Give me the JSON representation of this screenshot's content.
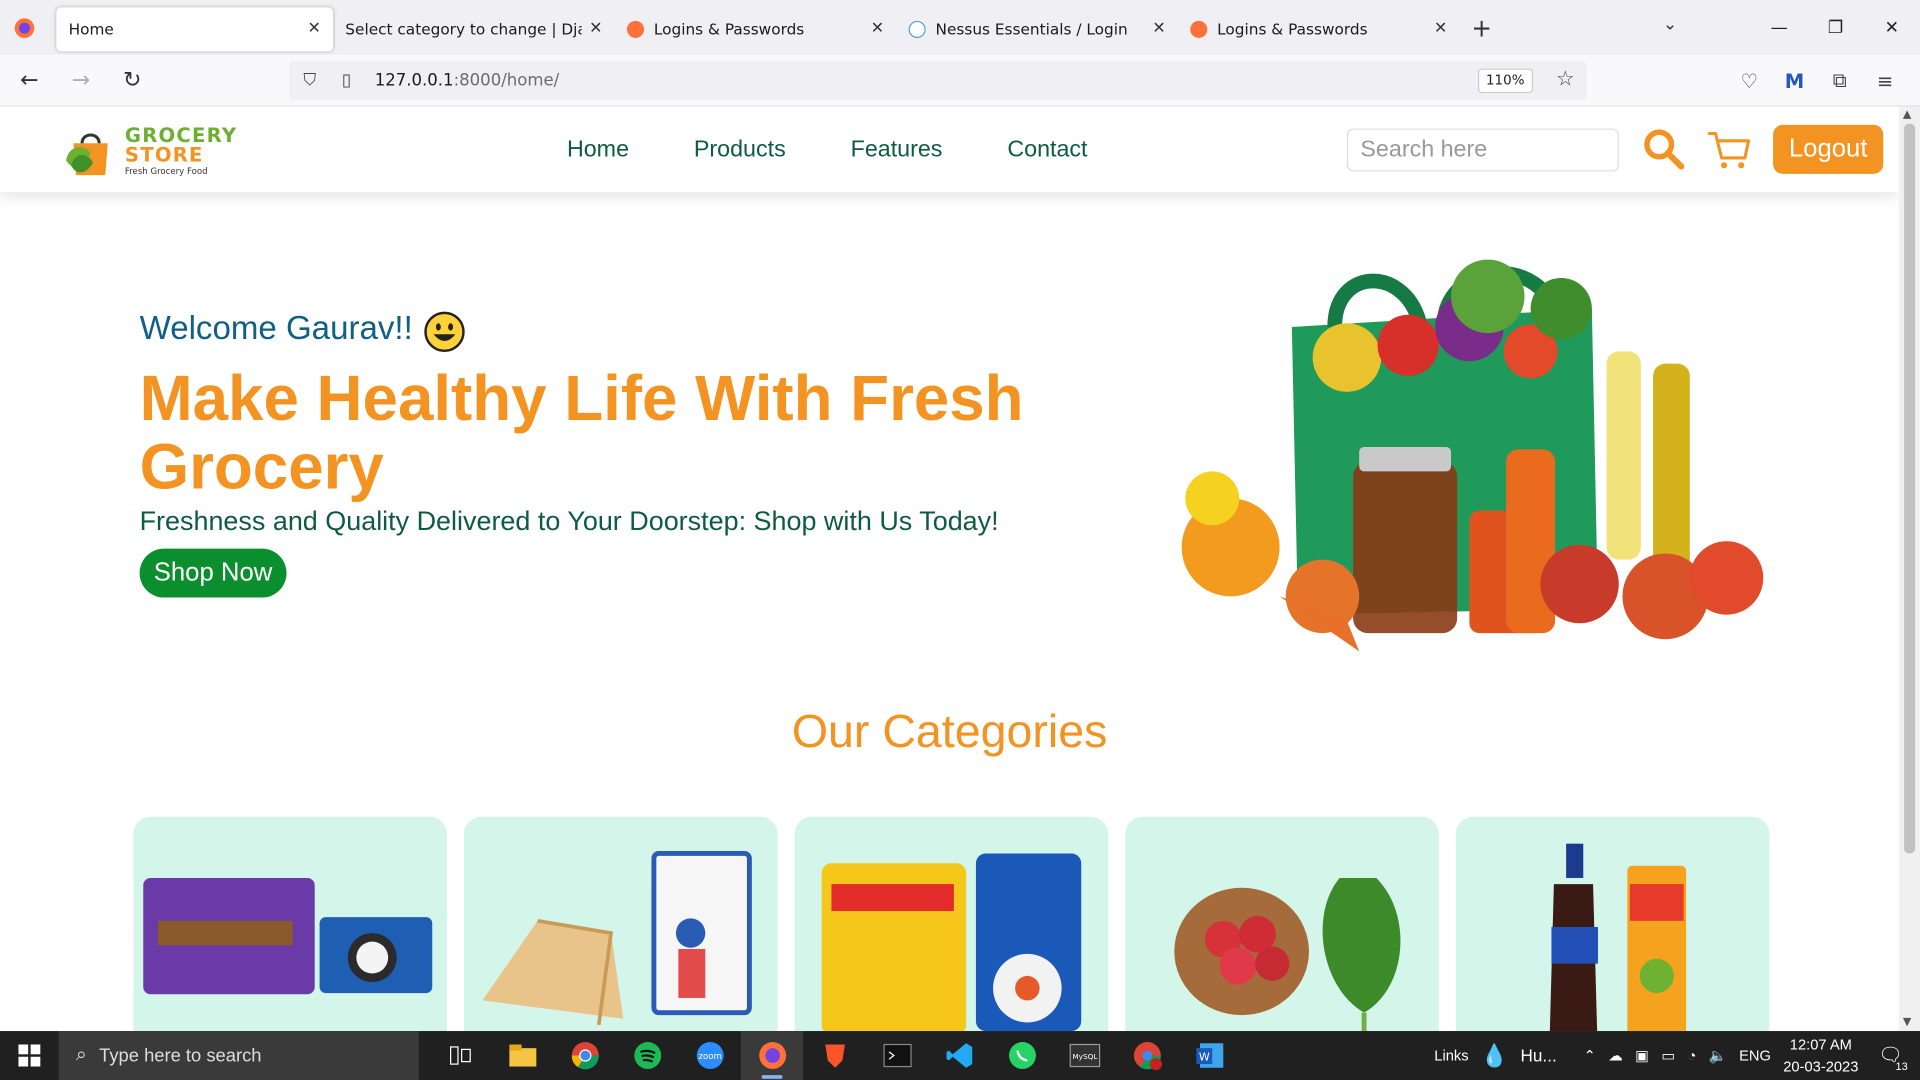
{
  "browser": {
    "tabs": [
      {
        "title": "Home",
        "active": true
      },
      {
        "title": "Select category to change | Django",
        "active": false
      },
      {
        "title": "Logins & Passwords",
        "active": false
      },
      {
        "title": "Nessus Essentials / Login",
        "active": false
      },
      {
        "title": "Logins & Passwords",
        "active": false
      }
    ],
    "url_host": "127.0.0.1",
    "url_path": ":8000/home/",
    "zoom": "110%"
  },
  "site": {
    "logo": {
      "line1": "GROCERY",
      "line2": "STORE",
      "tagline": "Fresh Grocery Food"
    },
    "menu": [
      "Home",
      "Products",
      "Features",
      "Contact"
    ],
    "search_placeholder": "Search here",
    "logout_label": "Logout",
    "welcome": "Welcome Gaurav!!",
    "headline": "Make Healthy Life With Fresh Grocery",
    "subtitle": "Freshness and Quality Delivered to Your Doorstep: Shop with Us Today!",
    "shop_button": "Shop Now",
    "categories_title": "Our Categories",
    "category_images": [
      "biscuits-chocolate-image",
      "bread-milk-image",
      "cereal-oats-image",
      "fruits-vegetables-image",
      "beverages-image"
    ]
  },
  "taskbar": {
    "search_placeholder": "Type here to search",
    "tray_links": "Links",
    "weather": "Hu...",
    "lang": "ENG",
    "time": "12:07 AM",
    "date": "20-03-2023",
    "notifications": "13"
  },
  "colors": {
    "accent_orange": "#f39321",
    "nav_green": "#0e5c40",
    "button_green": "#0b8f2e",
    "welcome_blue": "#0f5f86",
    "card_bg": "#d4f6ea"
  }
}
